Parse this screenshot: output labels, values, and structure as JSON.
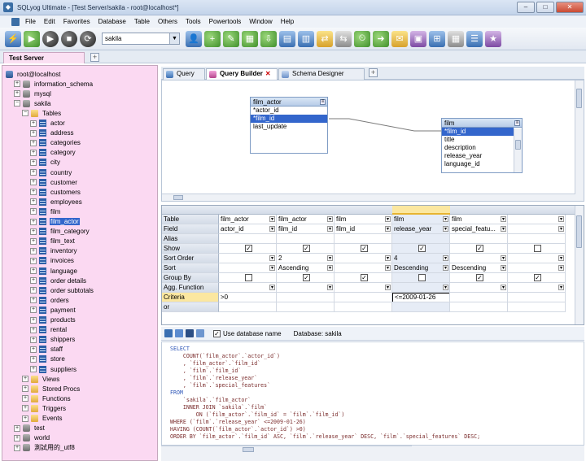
{
  "window": {
    "title": "SQLyog Ultimate - [Test Server/sakila - root@localhost*]",
    "min": "–",
    "max": "□",
    "close": "✕"
  },
  "menu": [
    "File",
    "Edit",
    "Favorites",
    "Database",
    "Table",
    "Others",
    "Tools",
    "Powertools",
    "Window",
    "Help"
  ],
  "toolbar": {
    "database": "sakila"
  },
  "connection_tab": "Test Server",
  "tree": {
    "root": "root@localhost",
    "databases": [
      "information_schema",
      "mysql",
      "sakila"
    ],
    "tables_folder": "Tables",
    "tables": [
      "actor",
      "address",
      "categories",
      "category",
      "city",
      "country",
      "customer",
      "customers",
      "employees",
      "film",
      "film_actor",
      "film_category",
      "film_text",
      "inventory",
      "invoices",
      "language",
      "order details",
      "order subtotals",
      "orders",
      "payment",
      "products",
      "rental",
      "shippers",
      "staff",
      "store",
      "suppliers"
    ],
    "selected": "film_actor",
    "folders": [
      "Views",
      "Stored Procs",
      "Functions",
      "Triggers",
      "Events"
    ],
    "other_dbs": [
      "test",
      "world",
      "測試用的_utf8"
    ]
  },
  "query_tabs": [
    {
      "label": "Query",
      "active": false
    },
    {
      "label": "Query Builder",
      "active": true
    },
    {
      "label": "Schema Designer",
      "active": false
    }
  ],
  "canvas": {
    "tables": [
      {
        "name": "film_actor",
        "rows": [
          "*actor_id",
          "*film_id",
          "last_update"
        ],
        "selected": 1
      },
      {
        "name": "film",
        "rows": [
          "*film_id",
          "title",
          "description",
          "release_year",
          "language_id"
        ],
        "selected": 0
      }
    ]
  },
  "grid": {
    "row_labels": [
      "Table",
      "Field",
      "Alias",
      "Show",
      "Sort Order",
      "Sort",
      "Group By",
      "Agg. Function",
      "Criteria",
      "or"
    ],
    "columns": [
      {
        "Table": "film_actor",
        "Field": "actor_id",
        "Show": true,
        "Sort Order": "",
        "Sort": "",
        "Group By": false,
        "Agg. Function": "count",
        "Criteria": ">0"
      },
      {
        "Table": "film_actor",
        "Field": "film_id",
        "Show": true,
        "Sort Order": "2",
        "Sort": "Ascending",
        "Group By": true,
        "Agg. Function": "",
        "Criteria": ""
      },
      {
        "Table": "film",
        "Field": "film_id",
        "Show": true,
        "Sort Order": "",
        "Sort": "",
        "Group By": true,
        "Agg. Function": "",
        "Criteria": ""
      },
      {
        "Table": "film",
        "Field": "release_year",
        "Show": true,
        "Sort Order": "4",
        "Sort": "Descending",
        "Group By": false,
        "Agg. Function": "",
        "Criteria": "<=2009-01-26"
      },
      {
        "Table": "film",
        "Field": "special_featu...",
        "Show": true,
        "Sort Order": "",
        "Sort": "Descending",
        "Group By": true,
        "Agg. Function": "",
        "Criteria": ""
      },
      {
        "Table": "",
        "Field": "",
        "Show": false,
        "Sort Order": "",
        "Sort": "",
        "Group By": true,
        "Agg. Function": "",
        "Criteria": ""
      }
    ]
  },
  "sqlbar": {
    "use_db_label": "Use database name",
    "database_label": "Database: sakila"
  },
  "sql": [
    {
      "text": "SELECT",
      "kw": true
    },
    {
      "text": "    COUNT(`film_actor`.`actor_id`)",
      "kw": false
    },
    {
      "text": "    , `film_actor`.`film_id`",
      "kw": false
    },
    {
      "text": "    , `film`.`film_id`",
      "kw": false
    },
    {
      "text": "    , `film`.`release_year`",
      "kw": false
    },
    {
      "text": "    , `film`.`special_features`",
      "kw": false
    },
    {
      "text": "FROM",
      "kw": true
    },
    {
      "text": "    `sakila`.`film_actor`",
      "kw": false
    },
    {
      "text": "    INNER JOIN `sakila`.`film`",
      "kw": false
    },
    {
      "text": "        ON (`film_actor`.`film_id` = `film`.`film_id`)",
      "kw": false
    },
    {
      "text": "WHERE (`film`.`release_year` <=2009-01-26)",
      "kw": false
    },
    {
      "text": "HAVING (COUNT(`film_actor`.`actor_id`) >0)",
      "kw": false
    },
    {
      "text": "ORDER BY `film_actor`.`film_id` ASC, `film`.`release_year` DESC, `film`.`special_features` DESC;",
      "kw": false
    }
  ]
}
